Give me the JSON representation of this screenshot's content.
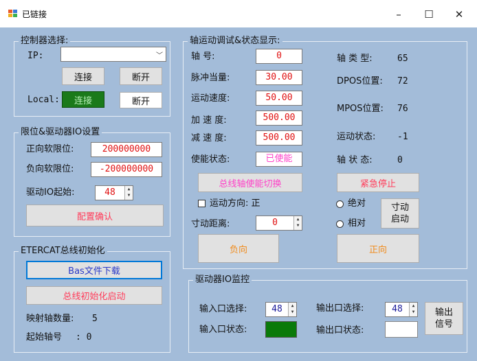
{
  "window": {
    "title": "已链接",
    "minimize": "–",
    "maximize": "☐",
    "close": "✕"
  },
  "controller": {
    "group_title": "控制器选择:",
    "ip_label": "IP:",
    "ip_value": "",
    "connect_label": "连接",
    "disconnect_label": "断开",
    "local_label": "Local:",
    "local_connect_label": "连接",
    "local_disconnect_label": "断开",
    "local_connected_color": "#1a7a1a"
  },
  "limits": {
    "group_title": "限位&驱动器IO设置",
    "fwd_label": "正向软限位:",
    "fwd_value": "200000000",
    "rev_label": "负向软限位:",
    "rev_value": "-200000000",
    "io_start_label": "驱动IO起始:",
    "io_start_value": "48",
    "confirm_label": "配置确认"
  },
  "ethercat": {
    "group_title": "ETERCAT总线初始化",
    "bas_download_label": "Bas文件下载",
    "init_label": "总线初始化启动",
    "axis_count_label": "映射轴数量:",
    "axis_count_value": "5",
    "start_axis_label": "起始轴号",
    "start_axis_value": ": 0"
  },
  "axis": {
    "group_title": "轴运动调试&状态显示:",
    "axis_no_label": "轴    号:",
    "axis_no_value": "0",
    "pulse_label": "脉冲当量:",
    "pulse_value": "30.00",
    "speed_label": "运动速度:",
    "speed_value": "50.00",
    "accel_label": "加 速 度:",
    "accel_value": "500.00",
    "decel_label": "减 速 度:",
    "decel_value": "500.00",
    "enable_label": "使能状态:",
    "enable_value": "已使能",
    "axis_type_label": "轴 类 型:",
    "axis_type_value": "65",
    "dpos_label": "DPOS位置:",
    "dpos_value": "72",
    "mpos_label": "MPOS位置:",
    "mpos_value": "76",
    "motion_state_label": "运动状态:",
    "motion_state_value": "-1",
    "axis_state_label": "轴 状 态:",
    "axis_state_value": "0",
    "bus_enable_toggle_label": "总线轴使能切换",
    "estop_label": "紧急停止",
    "direction_label": "运动方向: 正",
    "jog_dist_label": "寸动距离:",
    "jog_dist_value": "0",
    "absolute_label": "绝对",
    "relative_label": "相对",
    "jog_start_line1": "寸动",
    "jog_start_line2": "启动",
    "negative_label": "负向",
    "positive_label": "正向"
  },
  "driver_io": {
    "group_title": "驱动器IO监控",
    "in_select_label": "输入口选择:",
    "in_select_value": "48",
    "out_select_label": "输出口选择:",
    "out_select_value": "48",
    "in_state_label": "输入口状态:",
    "in_state_color": "#0a7a0a",
    "out_state_label": "输出口状态:",
    "out_state_color": "#ffffff",
    "output_btn_line1": "输出",
    "output_btn_line2": "信号"
  }
}
